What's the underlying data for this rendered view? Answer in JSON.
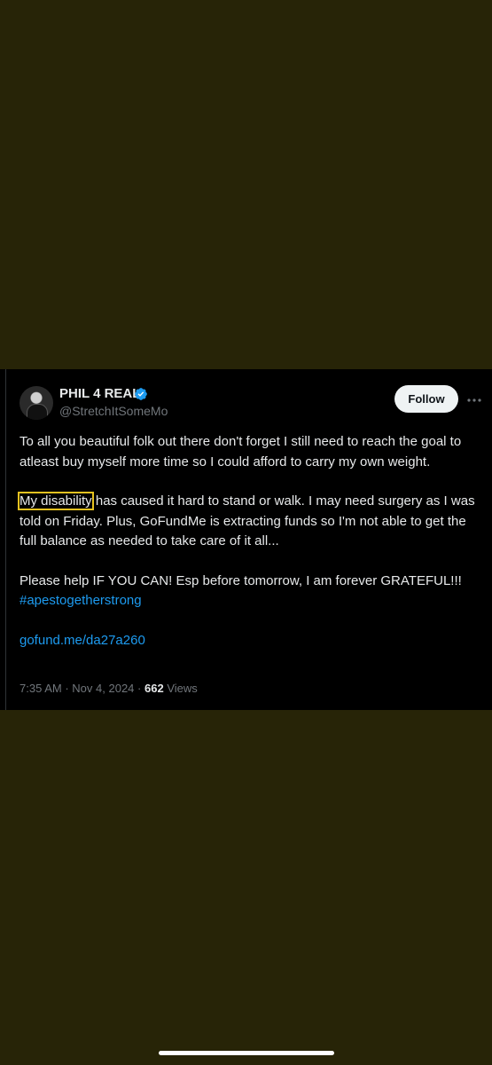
{
  "tweet": {
    "display_name": "PHIL 4 REAL",
    "handle": "@StretchItSomeMo",
    "follow_label": "Follow",
    "para1": "To all you beautiful folk out there don't forget I still need to reach the goal to atleast buy myself more time so I could afford to carry my own weight.",
    "para2_highlight": "My disability",
    "para2_rest": " has caused it hard to stand or walk. I may need surgery as I was told on Friday. Plus, GoFundMe is extracting funds so I'm not able to get the full balance as needed to take care of it all...",
    "para3": "Please help IF YOU CAN! Esp before tomorrow, I am forever GRATEFUL!!!",
    "hashtag": "#apestogetherstrong",
    "link": "gofund.me/da27a260",
    "time": "7:35 AM",
    "separator": "·",
    "date": "Nov 4, 2024",
    "views_count": "662",
    "views_label": "Views"
  },
  "colors": {
    "background": "#272407",
    "tweet_bg": "#000000",
    "link": "#1d9bf0",
    "highlight_box": "#e6c220",
    "verified": "#1d9bf0"
  },
  "icons": {
    "verified": "verified-badge-icon",
    "more": "more-options-icon"
  }
}
